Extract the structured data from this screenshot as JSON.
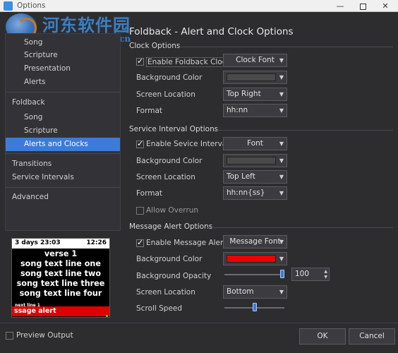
{
  "window": {
    "title": "Options"
  },
  "watermark": {
    "text": "河东软件园",
    "url": "www.pc0359.cn"
  },
  "sidebar": {
    "items": [
      {
        "label": "Song"
      },
      {
        "label": "Scripture"
      },
      {
        "label": "Presentation"
      },
      {
        "label": "Alerts"
      },
      {
        "label": "Foldback"
      },
      {
        "label": "Song"
      },
      {
        "label": "Scripture"
      },
      {
        "label": "Alerts and Clocks"
      },
      {
        "label": "Transitions"
      },
      {
        "label": "Service Intervals"
      },
      {
        "label": "Advanced"
      }
    ]
  },
  "preview": {
    "clock_left": "3 days 23:03",
    "clock_right": "12:26",
    "lines": [
      "verse 1",
      "song text line one",
      "song text line two",
      "song text line three",
      "song text line four"
    ],
    "next_line": "next line 1",
    "alert": "ssage alert",
    "checkbox_label": "Preview Output",
    "checked": false
  },
  "main": {
    "title": "Foldback - Alert and Clock Options",
    "clock": {
      "heading": "Clock Options",
      "enable_label": "Enable Foldback Clock",
      "enabled": true,
      "font_button": "Clock Font",
      "bg_label": "Background Color",
      "bg_color": "#4a4a4a",
      "location_label": "Screen Location",
      "location_value": "Top Right",
      "format_label": "Format",
      "format_value": "hh:nn"
    },
    "service": {
      "heading": "Service Interval Options",
      "enable_label": "Enable Sevice Interval",
      "enabled": true,
      "font_button": "Font",
      "bg_label": "Background Color",
      "bg_color": "#4a4a4a",
      "location_label": "Screen Location",
      "location_value": "Top Left",
      "format_label": "Format",
      "format_value": "hh:nn{ss}",
      "overrun_label": "Allow Overrun",
      "overrun": false
    },
    "message": {
      "heading": "Message Alert Options",
      "enable_label": "Enable Message Alert",
      "enabled": true,
      "font_button": "Message Font",
      "bg_label": "Background Color",
      "bg_color": "#ee0000",
      "opacity_label": "Background Opacity",
      "opacity_value": "100",
      "opacity_fraction": 1.0,
      "location_label": "Screen Location",
      "location_value": "Bottom",
      "scroll_label": "Scroll Speed",
      "scroll_fraction": 0.5
    }
  },
  "footer": {
    "ok": "OK",
    "cancel": "Cancel"
  },
  "colors": {
    "accent": "#3d7bd8",
    "background": "#2d2d30",
    "alert_red": "#ee0000"
  },
  "icons": {
    "check": "check-icon",
    "dropdown": "chevron-down-icon"
  }
}
